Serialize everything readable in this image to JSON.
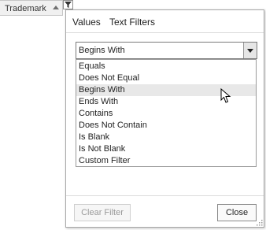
{
  "column_header": {
    "title": "Trademark",
    "sort_icon": "sort-ascending-icon",
    "filter_icon": "funnel-icon"
  },
  "tabs": [
    {
      "label": "Values",
      "active": false
    },
    {
      "label": "Text Filters",
      "active": true
    }
  ],
  "condition_select": {
    "selected": "Begins With",
    "options": [
      "Equals",
      "Does Not Equal",
      "Begins With",
      "Ends With",
      "Contains",
      "Does Not Contain",
      "Is Blank",
      "Is Not Blank",
      "Custom Filter"
    ],
    "hovered_index": 2
  },
  "buttons": {
    "clear_filter": "Clear Filter",
    "close": "Close"
  },
  "colors": {
    "hover_bg": "#e8e8e8",
    "border": "#a8a8a8",
    "disabled_text": "#9a9a9a"
  }
}
